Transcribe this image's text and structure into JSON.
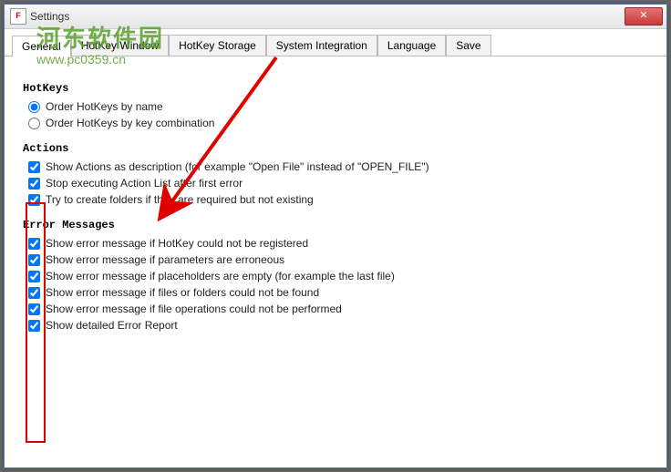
{
  "window": {
    "title": "Settings",
    "icon_label": "F"
  },
  "tabs": {
    "items": [
      {
        "label": "General",
        "active": true
      },
      {
        "label": "HotKey Window",
        "active": false
      },
      {
        "label": "HotKey Storage",
        "active": false
      },
      {
        "label": "System Integration",
        "active": false
      },
      {
        "label": "Language",
        "active": false
      },
      {
        "label": "Save",
        "active": false
      }
    ]
  },
  "sections": {
    "hotkeys": {
      "title": "HotKeys",
      "options": [
        {
          "name": "order-by-name",
          "label": "Order HotKeys by name",
          "checked": true
        },
        {
          "name": "order-by-combo",
          "label": "Order HotKeys by key combination",
          "checked": false
        }
      ]
    },
    "actions": {
      "title": "Actions",
      "options": [
        {
          "name": "show-actions-desc",
          "label": "Show Actions as description (for example \"Open File\" instead of \"OPEN_FILE\")",
          "checked": true
        },
        {
          "name": "stop-on-error",
          "label": "Stop executing Action List after first error",
          "checked": true
        },
        {
          "name": "create-folders",
          "label": "Try to create folders if they are required but not existing",
          "checked": true
        }
      ]
    },
    "errors": {
      "title": "Error Messages",
      "options": [
        {
          "name": "err-hotkey-reg",
          "label": "Show error message if HotKey could not be registered",
          "checked": true
        },
        {
          "name": "err-params",
          "label": "Show error message if parameters are erroneous",
          "checked": true
        },
        {
          "name": "err-placeholders",
          "label": "Show error message if placeholders are empty (for example the last file)",
          "checked": true
        },
        {
          "name": "err-files",
          "label": "Show error message if files or folders could not be found",
          "checked": true
        },
        {
          "name": "err-fileops",
          "label": "Show error message if file operations could not be performed",
          "checked": true
        },
        {
          "name": "err-report",
          "label": "Show detailed Error Report",
          "checked": true
        }
      ]
    }
  },
  "watermark": {
    "text": "河东软件园",
    "url": "www.pc0359.cn"
  },
  "close_button": {
    "label": "✕"
  }
}
